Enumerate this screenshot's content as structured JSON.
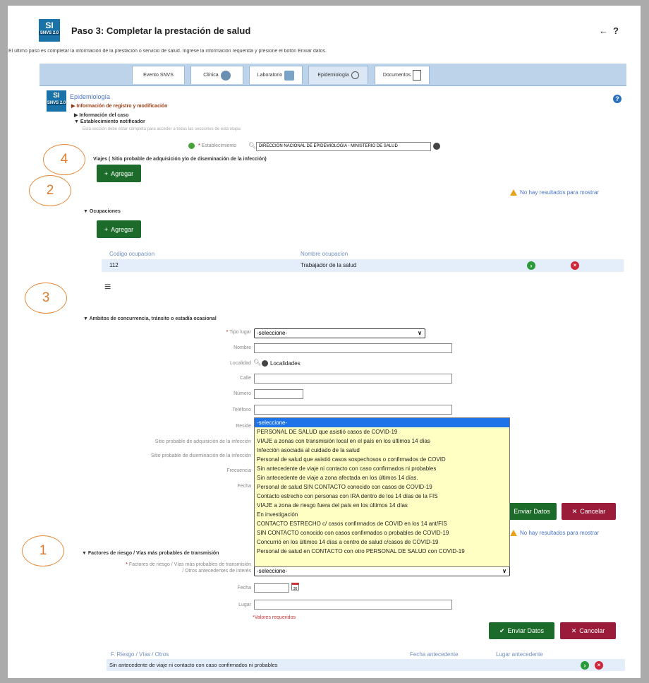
{
  "header": {
    "logo_mark": "SI",
    "logo_tag": "SNVS 2.0",
    "title": "Paso 3: Completar la prestación de salud",
    "back": "←",
    "help": "?",
    "description": "El último paso es completar la información de la prestación o servicio de salud. Ingrese la información requerida y presione el botón Enviar datos."
  },
  "tabs": [
    {
      "label": "Evento SNVS"
    },
    {
      "label": "Clínica"
    },
    {
      "label": "Laboratorio"
    },
    {
      "label": "Epidemiología"
    },
    {
      "label": "Documentos"
    }
  ],
  "epi": {
    "title": "Epidemiología",
    "help": "?",
    "sec_registro": "▶ Información de registro y modificación",
    "sec_caso": "▶ Información del caso",
    "sec_establecimiento": "▼ Establecimiento notificador",
    "establecimiento_note": "Esta sección debe estar completa para acceder a todas las secciones de esta etapa",
    "establecimiento_label": "Establecimiento",
    "establecimiento_value": "DIRECCION NACIONAL DE EPIDEMIOLOGIA - MINISTERIO DE SALUD",
    "viajes_title": "Viajes ( Sitio probable de adquisición y/o de diseminación de la infección)",
    "agregar": "Agregar",
    "no_results": "No hay resultados para mostrar",
    "ocupaciones_title": "▼ Ocupaciones",
    "ocup_headers": [
      "Codigo ocupacion",
      "Nombre ocupacion"
    ],
    "ocup_code": "112",
    "ocup_name": "Trabajador de la salud",
    "menu_icon": "≡",
    "ambitos_title": "▼ Ambitos de concurrencia, tránsito o estadía ocasional",
    "tipo_lugar_label": "Tipo lugar",
    "tipo_lugar_value": "-seleccione-",
    "nombre_label": "Nombre",
    "localidad_label": "Localidad",
    "localidades": "Localidades",
    "calle_label": "Calle",
    "numero_label": "Número",
    "telefono_label": "Teléfono",
    "reside_label": "Reside",
    "sitio_adq_label": "Sitio probable de adquisición de la infección",
    "sitio_dis_label": "Sitio probable de diseminación de la infección",
    "frecuencia_label": "Frecuencia",
    "fecha_label": "Fecha",
    "enviar": "Enviar Datos",
    "cancelar": "Cancelar",
    "factores_title": "▼ Factores de riesgo / Vías más probables de transmisión",
    "factores_label_1": "Factores de riesgo / Vías más probables de transmisión",
    "factores_label_2": "/ Otros antecedentes de interés",
    "factores_value": "-seleccione-",
    "fecha2_label": "Fecha",
    "lugar_label": "Lugar",
    "cal_icon": "30",
    "valores_requeridos": "*Valores requeridos",
    "fr_headers": [
      "F. Riesgo / Vías / Otros",
      "Fecha antecedente",
      "Lugar antecedente"
    ],
    "fr_row": "Sin antecedente de viaje ni contacto con caso confirmados ni probables"
  },
  "dropdown_options": [
    "-seleccione-",
    "PERSONAL DE SALUD que asistió casos de COVID-19",
    "VIAJE a zonas con transmisión local en el país en los últimos 14 días",
    "Infección asociada al cuidado de la salud",
    "Personal de salud que asistió casos sospechosos o confirmados de COVID",
    "Sin antecedente de viaje ni contacto con caso confirmados ni probables",
    "Sin antecedente de viaje a zona afectada en los últimos 14 días.",
    "Personal de salud SIN CONTACTO conocido con casos de COVID-19",
    "Contacto estrecho con personas con IRA dentro de los 14 días de la FIS",
    "VIAJE a zona de riesgo fuera del país en los últimos 14 días",
    "En investigación",
    "CONTACTO ESTRECHO c/ casos confirmados de COVID en los 14 ant/FIS",
    "SIN CONTACTO conocido con casos confirmados o probables de COVID-19",
    "Concurrió en los últimos 14 días a centro de salud c/casos de COVID-19",
    "Personal de salud en CONTACTO con otro PERSONAL DE SALUD con COVID-19"
  ],
  "callouts": [
    "4",
    "2",
    "3",
    "1"
  ],
  "colors": {
    "accent_green": "#1d6b2a",
    "cancel_red": "#9b1b3a",
    "callout_orange": "#e68a3c",
    "dropdown_bg": "#ffffc4",
    "selected_blue": "#1e73e8"
  }
}
